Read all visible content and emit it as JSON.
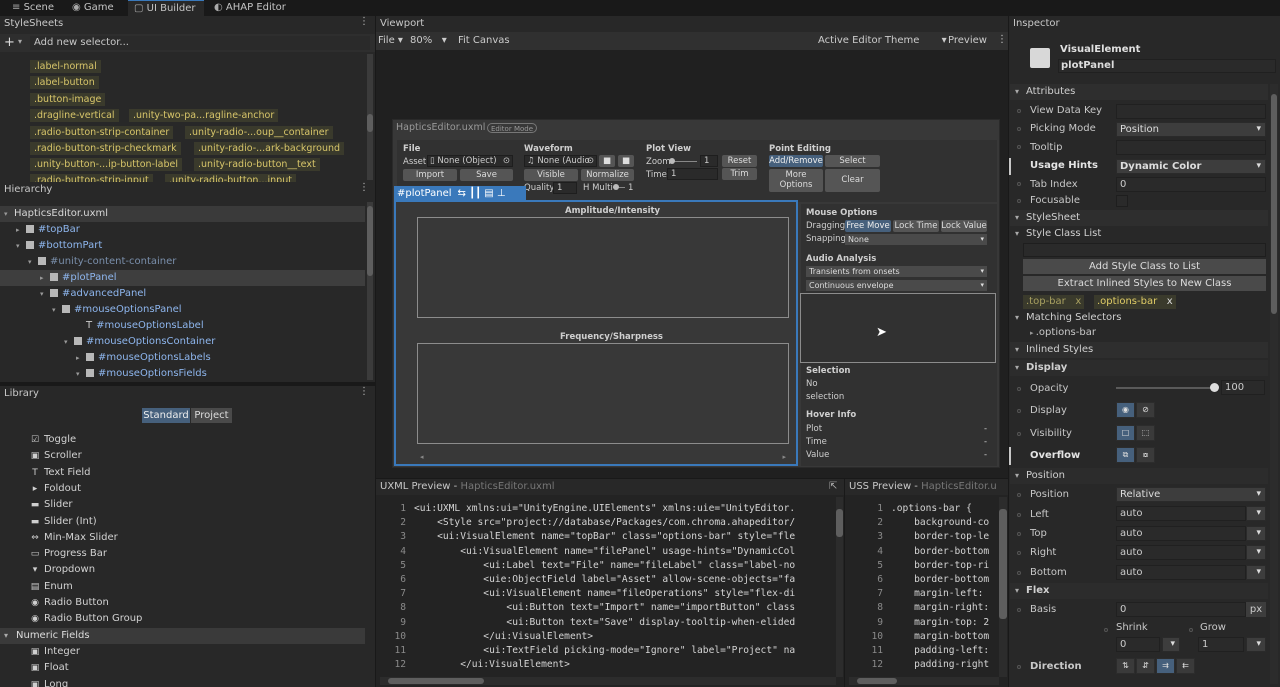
{
  "tabs": [
    "Scene",
    "Game",
    "UI Builder",
    "AHAP Editor"
  ],
  "stylesheets": {
    "title": "StyleSheets",
    "add_selector": "Add new selector...",
    "selectors": [
      ".label-normal",
      ".label-button",
      ".button-image",
      ".dragline-vertical",
      ".unity-two-pa...ragline-anchor",
      ".radio-button-strip-container",
      ".unity-radio-...oup__container",
      ".radio-button-strip-checkmark",
      ".unity-radio-...ark-background",
      ".unity-button-...ip-button-label",
      ".unity-radio-button__text",
      ".radio-button-strip-input",
      ".unity-radio-button...input"
    ]
  },
  "hierarchy": {
    "title": "Hierarchy",
    "items": [
      "HapticsEditor.uxml",
      "#topBar",
      "#bottomPart",
      "#unity-content-container",
      "#plotPanel",
      "#advancedPanel",
      "#mouseOptionsPanel",
      "#mouseOptionsLabel",
      "#mouseOptionsContainer",
      "#mouseOptionsLabels",
      "#mouseOptionsFields"
    ]
  },
  "library": {
    "title": "Library",
    "tab_standard": "Standard",
    "tab_project": "Project",
    "items": [
      [
        "Toggle",
        "☑"
      ],
      [
        "Scroller",
        "▣"
      ],
      [
        "Text Field",
        "T"
      ],
      [
        "Foldout",
        "▸"
      ],
      [
        "Slider",
        "▬"
      ],
      [
        "Slider (Int)",
        "▬"
      ],
      [
        "Min-Max Slider",
        "⇔"
      ],
      [
        "Progress Bar",
        "▭"
      ],
      [
        "Dropdown",
        "▾"
      ],
      [
        "Enum",
        "▤"
      ],
      [
        "Radio Button",
        "◉"
      ],
      [
        "Radio Button Group",
        "◉"
      ]
    ],
    "numeric_header": "Numeric Fields",
    "numeric": [
      [
        "Integer",
        "▣"
      ],
      [
        "Float",
        "▣"
      ],
      [
        "Long",
        "▣"
      ]
    ]
  },
  "viewport": {
    "title": "Viewport",
    "file": "File",
    "zoom": "80%",
    "fit": "Fit Canvas",
    "theme": "Active Editor Theme",
    "preview": "Preview",
    "doc_title": "HapticsEditor.uxml",
    "editor_mode": "Editor Mode",
    "file_label": "File",
    "asset_label": "Asset",
    "asset_value": "None (Object)",
    "import": "Import",
    "save": "Save",
    "waveform": "Waveform",
    "audio_value": "None (Audio",
    "visible": "Visible",
    "normalize": "Normalize",
    "quality": "Quality",
    "quality_val": "1",
    "hmulti": "H Multi",
    "hmulti_val": "1",
    "plot_view": "Plot View",
    "zoom_label": "Zoom",
    "zoom_val": "1",
    "reset": "Reset",
    "time_label": "Time",
    "time_val": "1",
    "trim": "Trim",
    "point_editing": "Point Editing",
    "add_remove": "Add/Remove",
    "select": "Select",
    "more_options": "More Options",
    "clear": "Clear",
    "plot_panel": "#plotPanel",
    "amp": "Amplitude/Intensity",
    "freq": "Frequency/Sharpness",
    "mouse_options": "Mouse Options",
    "dragging": "Dragging",
    "free_move": "Free Move",
    "lock_time": "Lock Time",
    "lock_value": "Lock Value",
    "snapping": "Snapping",
    "snap_val": "None",
    "audio_analysis": "Audio Analysis",
    "transients": "Transients from onsets",
    "envelope": "Continuous envelope",
    "selection": "Selection",
    "no": "No",
    "selection_word": "selection",
    "hover_info": "Hover Info",
    "plot": "Plot",
    "time": "Time",
    "value": "Value",
    "dash": "-"
  },
  "uxml": {
    "title": "UXML Preview",
    "file": "HapticsEditor.uxml",
    "lines": [
      "<ui:UXML xmlns:ui=\"UnityEngine.UIElements\" xmlns:uie=\"UnityEditor.",
      "    <Style src=\"project://database/Packages/com.chroma.ahapeditor/",
      "    <ui:VisualElement name=\"topBar\" class=\"options-bar\" style=\"fle",
      "        <ui:VisualElement name=\"filePanel\" usage-hints=\"DynamicCol",
      "            <ui:Label text=\"File\" name=\"fileLabel\" class=\"label-no",
      "            <uie:ObjectField label=\"Asset\" allow-scene-objects=\"fa",
      "            <ui:VisualElement name=\"fileOperations\" style=\"flex-di",
      "                <ui:Button text=\"Import\" name=\"importButton\" class",
      "                <ui:Button text=\"Save\" display-tooltip-when-elided",
      "            </ui:VisualElement>",
      "            <ui:TextField picking-mode=\"Ignore\" label=\"Project\" na",
      "        </ui:VisualElement>"
    ]
  },
  "uss": {
    "title": "USS Preview",
    "file": "HapticsEditor.u",
    "lines": [
      ".options-bar {",
      "    background-co",
      "    border-top-le",
      "    border-bottom",
      "    border-top-ri",
      "    border-bottom",
      "    margin-left:",
      "    margin-right:",
      "    margin-top: 2",
      "    margin-bottom",
      "    padding-left:",
      "    padding-right"
    ]
  },
  "inspector": {
    "title": "Inspector",
    "type": "VisualElement",
    "name": "plotPanel",
    "attributes": "Attributes",
    "view_data_key": "View Data Key",
    "picking_mode": "Picking Mode",
    "picking_val": "Position",
    "tooltip": "Tooltip",
    "usage_hints": "Usage Hints",
    "usage_val": "Dynamic Color",
    "tab_index": "Tab Index",
    "tab_val": "0",
    "focusable": "Focusable",
    "stylesheet": "StyleSheet",
    "style_class_list": "Style Class List",
    "add_style_class": "Add Style Class to List",
    "extract": "Extract Inlined Styles to New Class",
    "class1": ".top-bar",
    "class2": ".options-bar",
    "x": "x",
    "matching": "Matching Selectors",
    "matching_item": ".options-bar",
    "inlined": "Inlined Styles",
    "display": "Display",
    "opacity": "Opacity",
    "opacity_val": "100",
    "display_lbl": "Display",
    "visibility": "Visibility",
    "overflow": "Overflow",
    "position": "Position",
    "position_lbl": "Position",
    "position_val": "Relative",
    "left": "Left",
    "top": "Top",
    "right": "Right",
    "bottom": "Bottom",
    "auto": "auto",
    "flex": "Flex",
    "basis": "Basis",
    "basis_val": "0",
    "px": "px",
    "shrink": "Shrink",
    "shrink_val": "0",
    "grow": "Grow",
    "grow_val": "1",
    "direction": "Direction"
  }
}
